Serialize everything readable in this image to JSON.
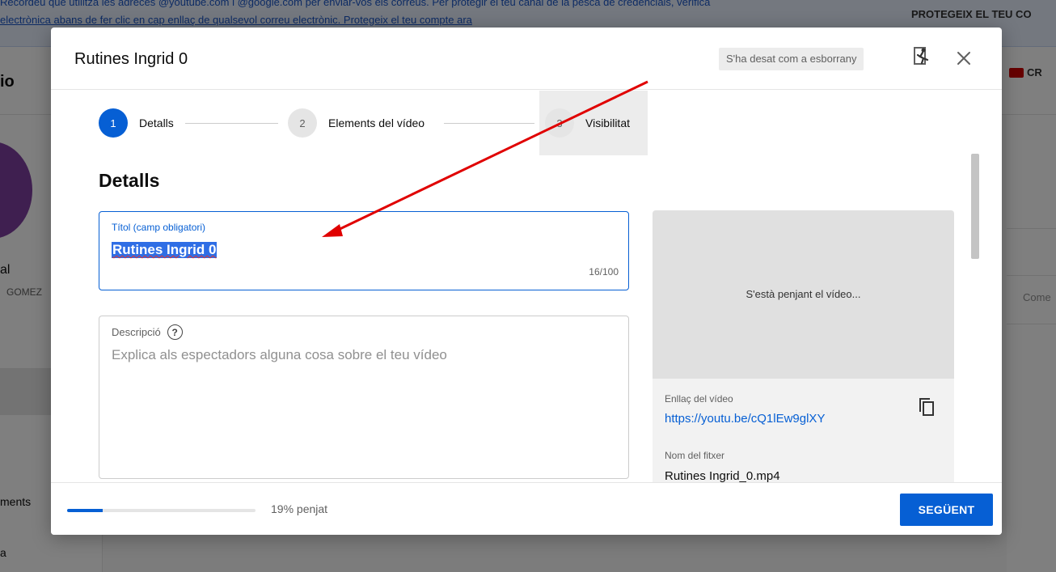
{
  "background": {
    "banner": {
      "line1": "Recordeu que utilitza les adreces @youtube.com i @google.com per enviar-vos els correus. Per protegir el teu canal de la pesca de credencials, verifica",
      "line2": "electrònica abans de fer clic en cap enllaç de qualsevol correu electrònic. Protegeix el teu compte ara",
      "cta": "PROTEGEIX EL TEU CO"
    },
    "logo_text": "io",
    "create_label": "CR",
    "channel_name": "al",
    "channel_sub": "GOMEZ",
    "sidebar_comments": "ments",
    "sidebar_item": "a",
    "right_col_text": "Come"
  },
  "dialog": {
    "title": "Rutines Ingrid 0",
    "draft_badge": "S'ha desat com a esborrany",
    "icons": {
      "feedback": "feedback-icon",
      "close": "close-icon",
      "copy": "copy-icon",
      "help": "help-icon"
    },
    "steps": [
      {
        "number": "1",
        "label": "Detalls",
        "state": "active"
      },
      {
        "number": "2",
        "label": "Elements del vídeo",
        "state": "inactive"
      },
      {
        "number": "3",
        "label": "Visibilitat",
        "state": "inactive"
      }
    ],
    "section_title": "Detalls",
    "title_field": {
      "label": "Títol (camp obligatori)",
      "value": "Rutines Ingrid 0",
      "counter": "16/100"
    },
    "description_field": {
      "label": "Descripció",
      "help_glyph": "?",
      "placeholder": "Explica als espectadors alguna cosa sobre el teu vídeo"
    },
    "preview": {
      "status": "S'està penjant el vídeo...",
      "link_label": "Enllaç del vídeo",
      "link_url": "https://youtu.be/cQ1lEw9glXY",
      "filename_label": "Nom del fitxer",
      "filename": "Rutines Ingrid_0.mp4"
    },
    "footer": {
      "progress_percent": 19,
      "progress_text": "19% penjat",
      "next_label": "SEGÜENT"
    }
  },
  "colors": {
    "accent": "#065fd4",
    "annotation_arrow": "#e00000",
    "selection": "#2f6ee5"
  }
}
